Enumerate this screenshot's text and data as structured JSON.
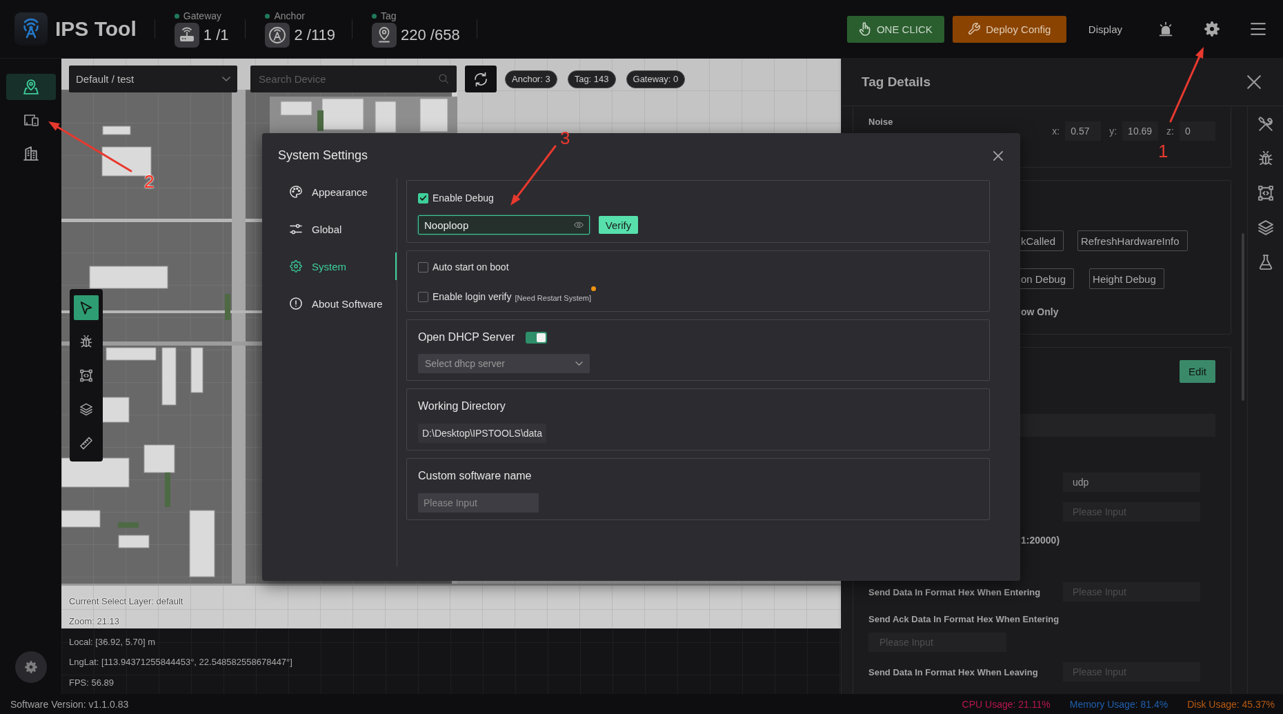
{
  "header": {
    "title": "IPS Tool",
    "stats": [
      {
        "kind": "gateway",
        "label": "Gateway",
        "value": "1 /1"
      },
      {
        "kind": "anchor",
        "label": "Anchor",
        "value": "2 /119"
      },
      {
        "kind": "tag",
        "label": "Tag",
        "value": "220 /658"
      }
    ],
    "buttons": [
      {
        "kind": "one_click",
        "label": "ONE CLICK"
      },
      {
        "kind": "deploy",
        "label": "Deploy Config"
      }
    ],
    "display": "Display"
  },
  "sidebar": {
    "items": [
      {
        "kind": "map",
        "selected": true
      },
      {
        "kind": "devices",
        "selected": false
      },
      {
        "kind": "building",
        "selected": false
      }
    ]
  },
  "map": {
    "layer": "Default / test",
    "search": {
      "placeholder": "Search Device"
    },
    "chips": [
      "Anchor: 3",
      "Tag: 143",
      "Gateway: 0"
    ],
    "tools": [
      {
        "kind": "pointer",
        "selected": true
      },
      {
        "kind": "bug",
        "selected": false
      },
      {
        "kind": "frame",
        "selected": false
      },
      {
        "kind": "layers",
        "selected": false
      },
      {
        "kind": "ruler",
        "selected": false
      }
    ],
    "info": [
      "Current Select Layer: default",
      "Zoom: 21.13",
      "Local: [36.92, 5.70] m",
      "LngLat: [113.94371255844453°, 22.548582558678447°]",
      "FPS: 56.89"
    ]
  },
  "tag_details": {
    "title": "Tag Details",
    "noise": {
      "label": "Noise",
      "coords": [
        {
          "label": "x:",
          "value": "0.57"
        },
        {
          "label": "y:",
          "value": "10.69"
        },
        {
          "label": "z:",
          "value": "0"
        }
      ]
    },
    "button_rows": [
      [
        "kCalled",
        "RefreshHardwareInfo"
      ],
      [
        "on Debug",
        "Height Debug"
      ]
    ],
    "note": "ow Only",
    "edit": "Edit",
    "rows": [
      {
        "kind": "wide_input"
      },
      {
        "kind": "input",
        "value": "udp"
      },
      {
        "kind": "input",
        "placeholder": "Please Input"
      },
      {
        "kind": "text",
        "text": "1:20000)"
      },
      {
        "kind": "labeled",
        "label": "Send Data In Format Hex When Entering",
        "placeholder": "Please Input"
      },
      {
        "kind": "stacked",
        "label": "Send Ack Data In Format Hex When Entering",
        "placeholder": "Please Input"
      },
      {
        "kind": "labeled",
        "label": "Send Data In Format Hex When Leaving",
        "placeholder": "Please Input"
      }
    ]
  },
  "settings_dialog": {
    "title": "System Settings",
    "nav": [
      {
        "kind": "appearance",
        "label": "Appearance",
        "selected": false
      },
      {
        "kind": "global",
        "label": "Global",
        "selected": false
      },
      {
        "kind": "system",
        "label": "System",
        "selected": true
      },
      {
        "kind": "about",
        "label": "About Software",
        "selected": false
      }
    ],
    "debug": {
      "label": "Enable Debug",
      "checked": true,
      "password": {
        "value": "Nooploop",
        "focused": true
      },
      "verify": "Verify"
    },
    "options": [
      {
        "label": "Auto start on boot",
        "checked": false,
        "badge": false
      },
      {
        "label": "Enable login verify",
        "note": "[Need Restart System]",
        "checked": false,
        "badge": true
      }
    ],
    "dhcp": {
      "label": "Open DHCP Server",
      "on": true,
      "placeholder": "Select dhcp server"
    },
    "working_directory": {
      "label": "Working Directory",
      "value": "D:\\Desktop\\IPSTOOLS\\data"
    },
    "custom_name": {
      "label": "Custom software name",
      "placeholder": "Please Input"
    }
  },
  "status_bar": {
    "version": "Software Version: v1.1.0.83",
    "metrics": [
      {
        "label": "CPU Usage: 21.11%",
        "color": "#b8164f"
      },
      {
        "label": "Memory Usage: 81.4%",
        "color": "#1f5fae"
      },
      {
        "label": "Disk Usage: 45.37%",
        "color": "#b85a12"
      }
    ]
  },
  "annotations": [
    {
      "label": "1"
    },
    {
      "label": "2"
    },
    {
      "label": "3"
    }
  ]
}
